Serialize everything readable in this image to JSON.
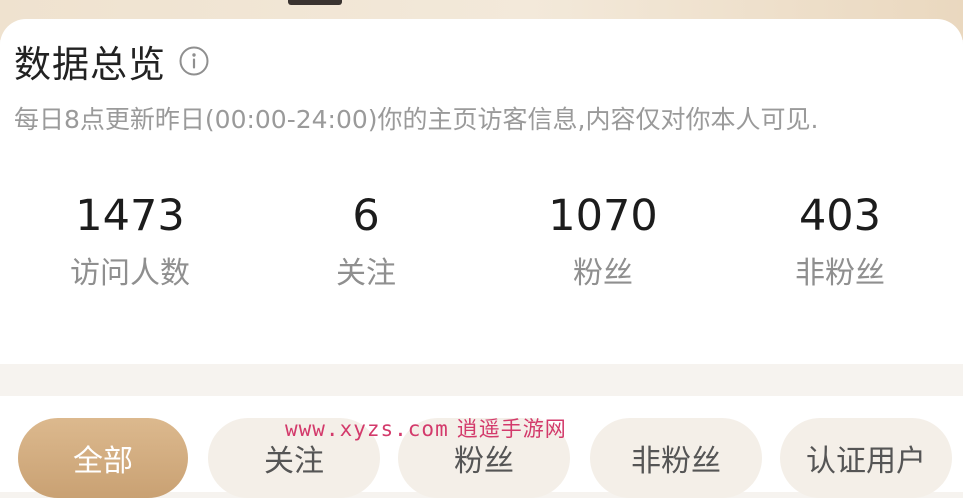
{
  "overview": {
    "title": "数据总览",
    "subtitle": "每日8点更新昨日(00:00-24:00)你的主页访客信息,内容仅对你本人可见."
  },
  "stats": [
    {
      "value": "1473",
      "label": "访问人数"
    },
    {
      "value": "6",
      "label": "关注"
    },
    {
      "value": "1070",
      "label": "粉丝"
    },
    {
      "value": "403",
      "label": "非粉丝"
    }
  ],
  "filter_tabs": [
    {
      "label": "全部",
      "active": true
    },
    {
      "label": "关注",
      "active": false
    },
    {
      "label": "粉丝",
      "active": false
    },
    {
      "label": "非粉丝",
      "active": false
    },
    {
      "label": "认证用户",
      "active": false
    }
  ],
  "watermark": {
    "url": "www.xyzs.com",
    "name": "逍遥手游网"
  },
  "colors": {
    "accent_gold": "#c9a173",
    "tab_bg": "#f4efe8",
    "watermark": "#d33a6b"
  }
}
